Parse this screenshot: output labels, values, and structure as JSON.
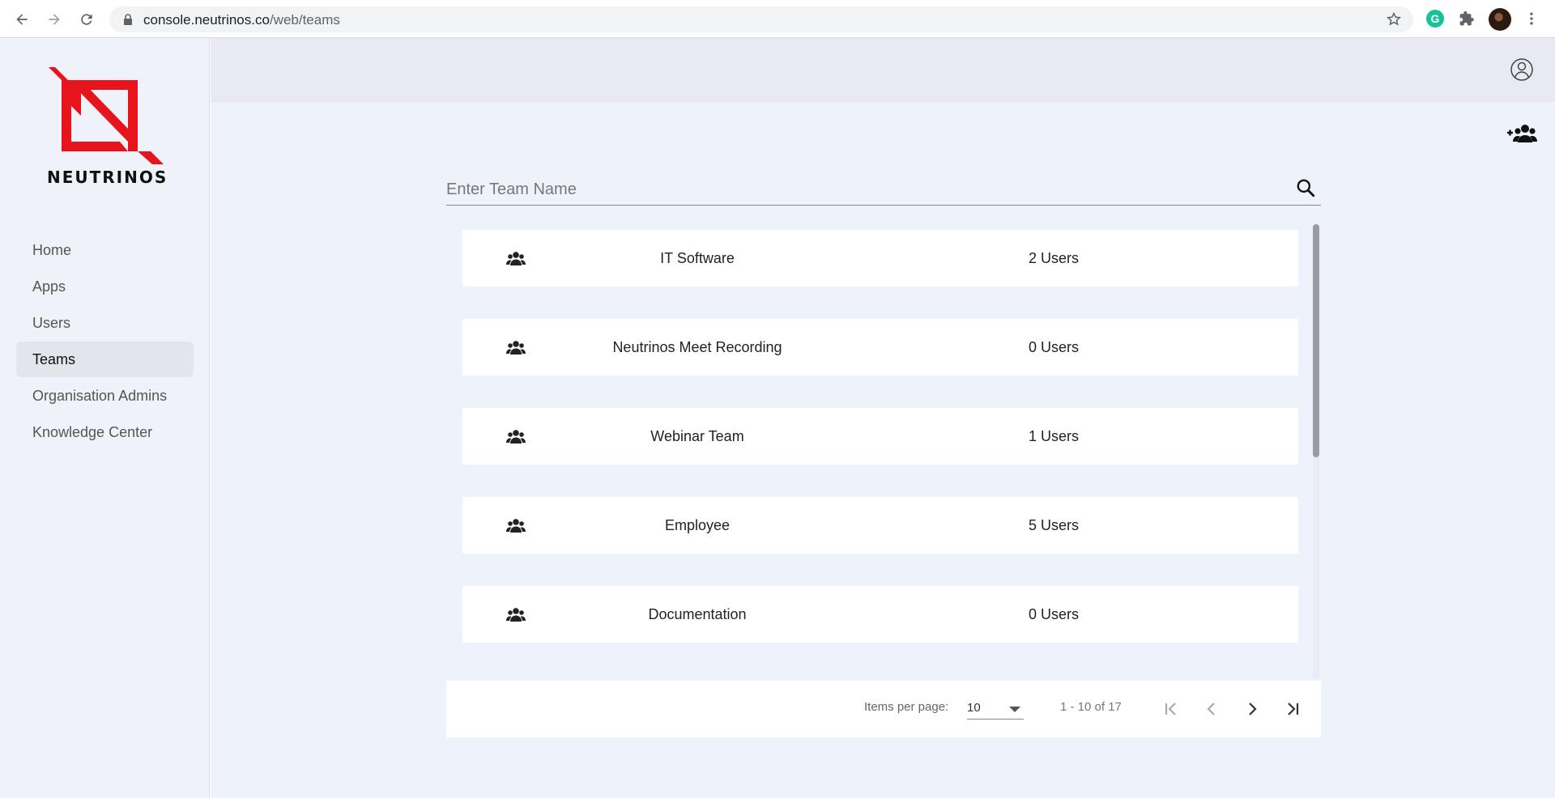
{
  "browser": {
    "url_host": "console.neutrinos.co",
    "url_path": "/web/teams"
  },
  "brand": {
    "name": "NEUTRINOS",
    "logo_color": "#e8141c"
  },
  "sidebar": {
    "items": [
      {
        "label": "Home",
        "active": false
      },
      {
        "label": "Apps",
        "active": false
      },
      {
        "label": "Users",
        "active": false
      },
      {
        "label": "Teams",
        "active": true
      },
      {
        "label": "Organisation Admins",
        "active": false
      },
      {
        "label": "Knowledge Center",
        "active": false
      }
    ]
  },
  "header": {
    "account_icon": "account-circle-icon",
    "add_team_icon": "add-group-icon"
  },
  "search": {
    "placeholder": "Enter Team Name",
    "value": ""
  },
  "teams": [
    {
      "name": "IT Software",
      "count": "2 Users"
    },
    {
      "name": "Neutrinos Meet Recording",
      "count": "0 Users"
    },
    {
      "name": "Webinar Team",
      "count": "1 Users"
    },
    {
      "name": "Employee",
      "count": "5 Users"
    },
    {
      "name": "Documentation",
      "count": "0 Users"
    }
  ],
  "paginator": {
    "items_per_page_label": "Items per page:",
    "items_per_page_value": "10",
    "range_label": "1 - 10 of 17"
  },
  "colors": {
    "accent": "#e8141c",
    "active_menu_bg": "#e3e4ec",
    "main_bg": "#eef2fb"
  }
}
